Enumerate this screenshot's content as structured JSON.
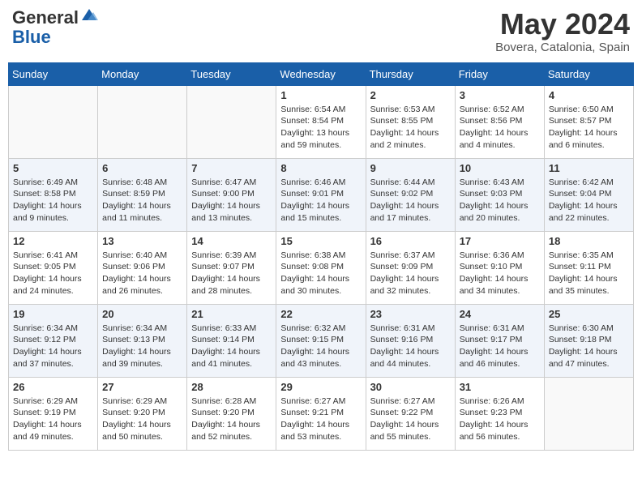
{
  "header": {
    "logo_general": "General",
    "logo_blue": "Blue",
    "month_title": "May 2024",
    "location": "Bovera, Catalonia, Spain"
  },
  "calendar": {
    "days_of_week": [
      "Sunday",
      "Monday",
      "Tuesday",
      "Wednesday",
      "Thursday",
      "Friday",
      "Saturday"
    ],
    "weeks": [
      {
        "alt": false,
        "days": [
          {
            "num": "",
            "info": ""
          },
          {
            "num": "",
            "info": ""
          },
          {
            "num": "",
            "info": ""
          },
          {
            "num": "1",
            "info": "Sunrise: 6:54 AM\nSunset: 8:54 PM\nDaylight: 13 hours\nand 59 minutes."
          },
          {
            "num": "2",
            "info": "Sunrise: 6:53 AM\nSunset: 8:55 PM\nDaylight: 14 hours\nand 2 minutes."
          },
          {
            "num": "3",
            "info": "Sunrise: 6:52 AM\nSunset: 8:56 PM\nDaylight: 14 hours\nand 4 minutes."
          },
          {
            "num": "4",
            "info": "Sunrise: 6:50 AM\nSunset: 8:57 PM\nDaylight: 14 hours\nand 6 minutes."
          }
        ]
      },
      {
        "alt": true,
        "days": [
          {
            "num": "5",
            "info": "Sunrise: 6:49 AM\nSunset: 8:58 PM\nDaylight: 14 hours\nand 9 minutes."
          },
          {
            "num": "6",
            "info": "Sunrise: 6:48 AM\nSunset: 8:59 PM\nDaylight: 14 hours\nand 11 minutes."
          },
          {
            "num": "7",
            "info": "Sunrise: 6:47 AM\nSunset: 9:00 PM\nDaylight: 14 hours\nand 13 minutes."
          },
          {
            "num": "8",
            "info": "Sunrise: 6:46 AM\nSunset: 9:01 PM\nDaylight: 14 hours\nand 15 minutes."
          },
          {
            "num": "9",
            "info": "Sunrise: 6:44 AM\nSunset: 9:02 PM\nDaylight: 14 hours\nand 17 minutes."
          },
          {
            "num": "10",
            "info": "Sunrise: 6:43 AM\nSunset: 9:03 PM\nDaylight: 14 hours\nand 20 minutes."
          },
          {
            "num": "11",
            "info": "Sunrise: 6:42 AM\nSunset: 9:04 PM\nDaylight: 14 hours\nand 22 minutes."
          }
        ]
      },
      {
        "alt": false,
        "days": [
          {
            "num": "12",
            "info": "Sunrise: 6:41 AM\nSunset: 9:05 PM\nDaylight: 14 hours\nand 24 minutes."
          },
          {
            "num": "13",
            "info": "Sunrise: 6:40 AM\nSunset: 9:06 PM\nDaylight: 14 hours\nand 26 minutes."
          },
          {
            "num": "14",
            "info": "Sunrise: 6:39 AM\nSunset: 9:07 PM\nDaylight: 14 hours\nand 28 minutes."
          },
          {
            "num": "15",
            "info": "Sunrise: 6:38 AM\nSunset: 9:08 PM\nDaylight: 14 hours\nand 30 minutes."
          },
          {
            "num": "16",
            "info": "Sunrise: 6:37 AM\nSunset: 9:09 PM\nDaylight: 14 hours\nand 32 minutes."
          },
          {
            "num": "17",
            "info": "Sunrise: 6:36 AM\nSunset: 9:10 PM\nDaylight: 14 hours\nand 34 minutes."
          },
          {
            "num": "18",
            "info": "Sunrise: 6:35 AM\nSunset: 9:11 PM\nDaylight: 14 hours\nand 35 minutes."
          }
        ]
      },
      {
        "alt": true,
        "days": [
          {
            "num": "19",
            "info": "Sunrise: 6:34 AM\nSunset: 9:12 PM\nDaylight: 14 hours\nand 37 minutes."
          },
          {
            "num": "20",
            "info": "Sunrise: 6:34 AM\nSunset: 9:13 PM\nDaylight: 14 hours\nand 39 minutes."
          },
          {
            "num": "21",
            "info": "Sunrise: 6:33 AM\nSunset: 9:14 PM\nDaylight: 14 hours\nand 41 minutes."
          },
          {
            "num": "22",
            "info": "Sunrise: 6:32 AM\nSunset: 9:15 PM\nDaylight: 14 hours\nand 43 minutes."
          },
          {
            "num": "23",
            "info": "Sunrise: 6:31 AM\nSunset: 9:16 PM\nDaylight: 14 hours\nand 44 minutes."
          },
          {
            "num": "24",
            "info": "Sunrise: 6:31 AM\nSunset: 9:17 PM\nDaylight: 14 hours\nand 46 minutes."
          },
          {
            "num": "25",
            "info": "Sunrise: 6:30 AM\nSunset: 9:18 PM\nDaylight: 14 hours\nand 47 minutes."
          }
        ]
      },
      {
        "alt": false,
        "days": [
          {
            "num": "26",
            "info": "Sunrise: 6:29 AM\nSunset: 9:19 PM\nDaylight: 14 hours\nand 49 minutes."
          },
          {
            "num": "27",
            "info": "Sunrise: 6:29 AM\nSunset: 9:20 PM\nDaylight: 14 hours\nand 50 minutes."
          },
          {
            "num": "28",
            "info": "Sunrise: 6:28 AM\nSunset: 9:20 PM\nDaylight: 14 hours\nand 52 minutes."
          },
          {
            "num": "29",
            "info": "Sunrise: 6:27 AM\nSunset: 9:21 PM\nDaylight: 14 hours\nand 53 minutes."
          },
          {
            "num": "30",
            "info": "Sunrise: 6:27 AM\nSunset: 9:22 PM\nDaylight: 14 hours\nand 55 minutes."
          },
          {
            "num": "31",
            "info": "Sunrise: 6:26 AM\nSunset: 9:23 PM\nDaylight: 14 hours\nand 56 minutes."
          },
          {
            "num": "",
            "info": ""
          }
        ]
      }
    ]
  }
}
